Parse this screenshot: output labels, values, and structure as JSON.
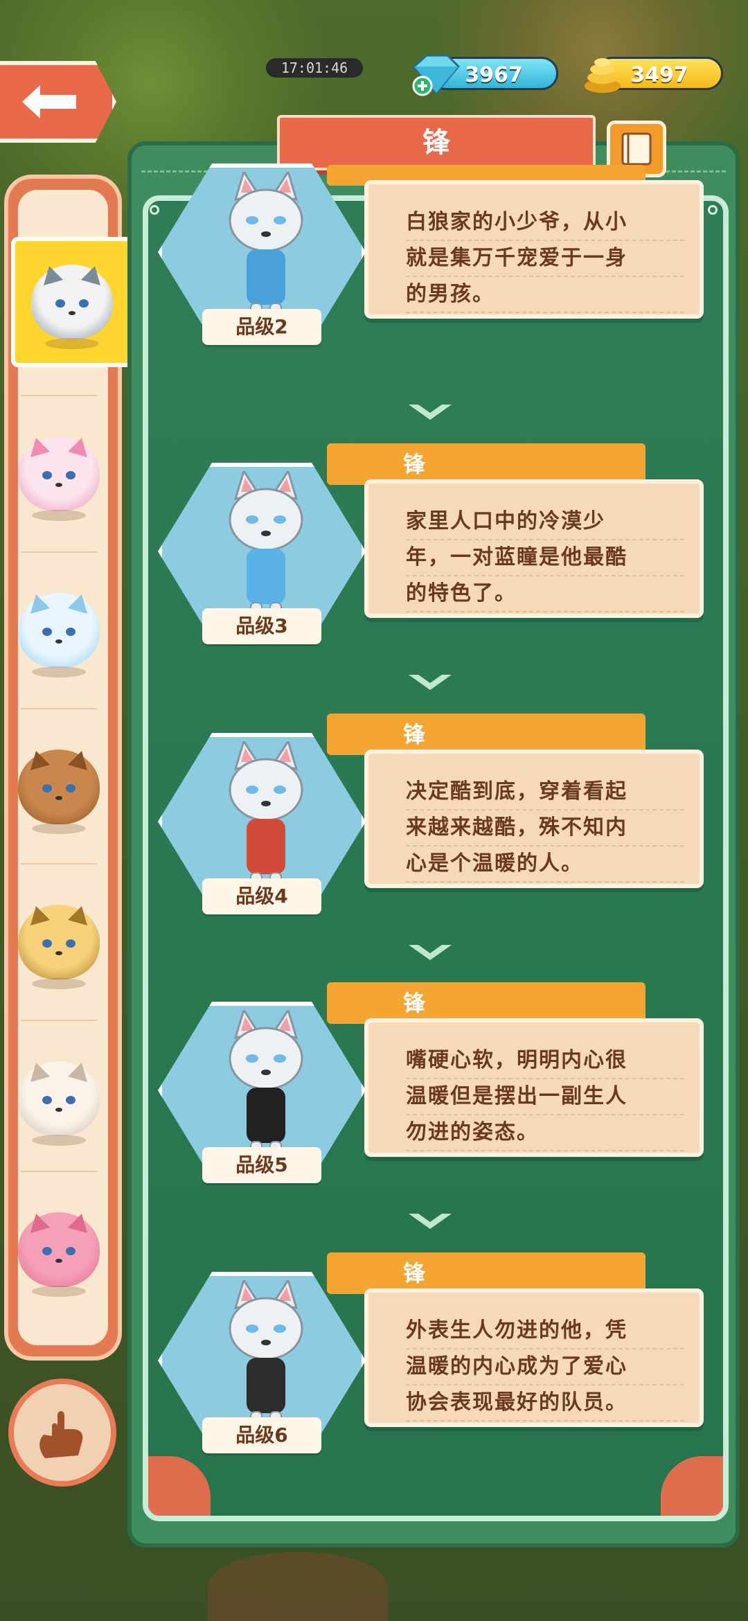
{
  "status": {
    "clock": "17:01:46"
  },
  "currency": {
    "gems": "3967",
    "coins": "3497"
  },
  "header": {
    "title": "锋"
  },
  "sidebar": {
    "pets": [
      {
        "name": "wolf",
        "color": "#f2f2f2",
        "accent": "#7a8b99",
        "selected": true
      },
      {
        "name": "pink-cat",
        "color": "#fbe4ee",
        "accent": "#f08cb4",
        "selected": false
      },
      {
        "name": "white-fox",
        "color": "#eaf6ff",
        "accent": "#8cc8ea",
        "selected": false
      },
      {
        "name": "owl",
        "color": "#c9874d",
        "accent": "#8a5326",
        "selected": false
      },
      {
        "name": "leopard",
        "color": "#f7d27a",
        "accent": "#a4762a",
        "selected": false
      },
      {
        "name": "polar-bear",
        "color": "#fbf3ea",
        "accent": "#c9b8a8",
        "selected": false
      },
      {
        "name": "pink-sheep",
        "color": "#f6a0b8",
        "accent": "#e06a8c",
        "selected": false
      }
    ]
  },
  "entries": [
    {
      "name": "锋",
      "grade": "品级2",
      "lines": [
        "白狼家的小少爷，从小",
        "就是集万千宠爱于一身",
        "的男孩。"
      ],
      "outfit": "#4aa0d8"
    },
    {
      "name": "锋",
      "grade": "品级3",
      "lines": [
        "家里人口中的冷漠少",
        "年，一对蓝瞳是他最酷",
        "的特色了。"
      ],
      "outfit": "#5bb2e6"
    },
    {
      "name": "锋",
      "grade": "品级4",
      "lines": [
        "决定酷到底，穿着看起",
        "来越来越酷，殊不知内",
        "心是个温暖的人。"
      ],
      "outfit": "#d24a3a"
    },
    {
      "name": "锋",
      "grade": "品级5",
      "lines": [
        "嘴硬心软，明明内心很",
        "温暖但是摆出一副生人",
        "勿进的姿态。"
      ],
      "outfit": "#222222"
    },
    {
      "name": "锋",
      "grade": "品级6",
      "lines": [
        "外表生人勿进的他，凭",
        "温暖的内心成为了爱心",
        "协会表现最好的队员。"
      ],
      "outfit": "#2c2c2c"
    }
  ],
  "colors": {
    "panel": "#3f8d5f",
    "accent_orange": "#f3a431",
    "title_red": "#e8684a"
  }
}
